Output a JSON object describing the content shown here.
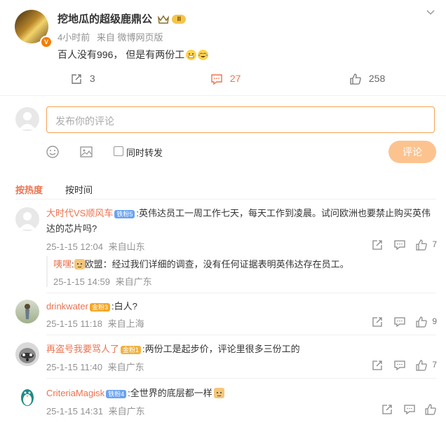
{
  "post": {
    "author": "挖地瓜的超级鹿鼎公",
    "time": "4小时前",
    "source": "来自 微博网页版",
    "text": "百人没有996， 但是有两份工",
    "repost_count": "3",
    "comment_count": "27",
    "like_count": "258"
  },
  "composer": {
    "placeholder": "发布你的评论",
    "also_repost": "同时转发",
    "submit": "评论"
  },
  "sort": {
    "hot": "按热度",
    "time": "按时间"
  },
  "comments": [
    {
      "name": "大时代VS顺风车",
      "badge": "铁粉5",
      "text": ":英伟达员工一周工作七天，每天工作到凌晨。试问欧洲也要禁止购买英伟达的芯片吗?",
      "date": "25-1-15 12:04",
      "loc": "来自山东",
      "likes": "7",
      "reply": {
        "name": "咦嘿",
        "rest": "欧盟：经过我们详细的调查，没有任何证据表明英伟达存在员工。",
        "date": "25-1-15 14:59",
        "loc": "来自广东"
      }
    },
    {
      "name": "drinkwater",
      "badge": "金粉3",
      "text": ":白人?",
      "date": "25-1-15 11:18",
      "loc": "来自上海",
      "likes": "9"
    },
    {
      "name": "再盗号我要骂人了",
      "badge": "金粉1",
      "text": ":两份工是起步价，评论里很多三份工的",
      "date": "25-1-15 11:40",
      "loc": "来自广东",
      "likes": "7"
    },
    {
      "name": "CriteriaMagisk",
      "badge": "铁粉4",
      "text": ":全世界的底层都一样",
      "date": "25-1-15 14:31",
      "loc": "来自广东",
      "likes": ""
    }
  ]
}
